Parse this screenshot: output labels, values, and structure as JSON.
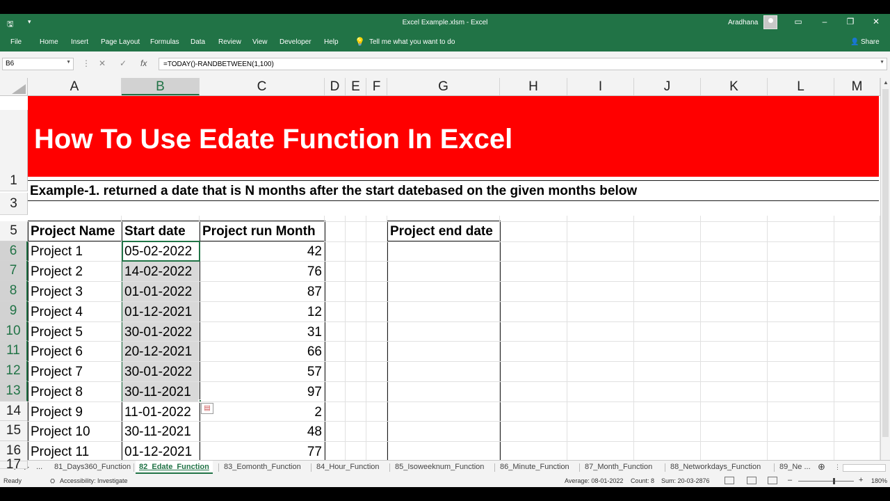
{
  "title_bar": {
    "title": "Excel Example.xlsm  -  Excel",
    "user": "Aradhana",
    "qat_save_icon": "save-icon",
    "qat_more": "▾"
  },
  "ribbon": {
    "tabs": [
      "File",
      "Home",
      "Insert",
      "Page Layout",
      "Formulas",
      "Data",
      "Review",
      "View",
      "Developer",
      "Help"
    ],
    "tell_me": "Tell me what you want to do",
    "share": "Share"
  },
  "formula_bar": {
    "name_box": "B6",
    "formula": "=TODAY()-RANDBETWEEN(1,100)",
    "fx": "fx",
    "cancel": "✕",
    "enter": "✓"
  },
  "columns": [
    {
      "label": "A",
      "selected": false
    },
    {
      "label": "B",
      "selected": true
    },
    {
      "label": "C",
      "selected": false
    },
    {
      "label": "D",
      "selected": false
    },
    {
      "label": "E",
      "selected": false
    },
    {
      "label": "F",
      "selected": false
    },
    {
      "label": "G",
      "selected": false
    },
    {
      "label": "H",
      "selected": false
    },
    {
      "label": "I",
      "selected": false
    },
    {
      "label": "J",
      "selected": false
    },
    {
      "label": "K",
      "selected": false
    },
    {
      "label": "L",
      "selected": false
    },
    {
      "label": "M",
      "selected": false
    }
  ],
  "rows": [
    {
      "label": "1",
      "selected": false
    },
    {
      "label": "3",
      "selected": false
    },
    {
      "label": "5",
      "selected": false
    },
    {
      "label": "6",
      "selected": true
    },
    {
      "label": "7",
      "selected": true
    },
    {
      "label": "8",
      "selected": true
    },
    {
      "label": "9",
      "selected": true
    },
    {
      "label": "10",
      "selected": true
    },
    {
      "label": "11",
      "selected": true
    },
    {
      "label": "12",
      "selected": true
    },
    {
      "label": "13",
      "selected": true
    },
    {
      "label": "14",
      "selected": false
    },
    {
      "label": "15",
      "selected": false
    },
    {
      "label": "16",
      "selected": false
    },
    {
      "label": "17",
      "selected": false
    }
  ],
  "sheet": {
    "banner_title": "How To Use  Edate  Function In Excel",
    "banner_color": "#ff0000",
    "example_heading": "Example-1.  returned a date that is N months after the start datebased on the given months below",
    "table_headers": [
      "Project Name",
      "Start date",
      "Project run Month"
    ],
    "result_header": "Project end date",
    "table_rows": [
      {
        "name": "Project 1",
        "start": "05-02-2022",
        "months": "42"
      },
      {
        "name": "Project 2",
        "start": "14-02-2022",
        "months": "76"
      },
      {
        "name": "Project 3",
        "start": "01-01-2022",
        "months": "87"
      },
      {
        "name": "Project 4",
        "start": "01-12-2021",
        "months": "12"
      },
      {
        "name": "Project 5",
        "start": "30-01-2022",
        "months": "31"
      },
      {
        "name": "Project 6",
        "start": "20-12-2021",
        "months": "66"
      },
      {
        "name": "Project 7",
        "start": "30-01-2022",
        "months": "57"
      },
      {
        "name": "Project 8",
        "start": "30-11-2021",
        "months": "97"
      },
      {
        "name": "Project 9",
        "start": "11-01-2022",
        "months": "2"
      },
      {
        "name": "Project 10",
        "start": "30-11-2021",
        "months": "48"
      },
      {
        "name": "Project 11",
        "start": "01-12-2021",
        "months": "77"
      }
    ]
  },
  "sheet_tabs": {
    "ellipsis": "...",
    "tabs": [
      {
        "label": "81_Days360_Function",
        "active": false
      },
      {
        "label": "82_Edate_Function",
        "active": true
      },
      {
        "label": "83_Eomonth_Function",
        "active": false
      },
      {
        "label": "84_Hour_Function",
        "active": false
      },
      {
        "label": "85_Isoweeknum_Function",
        "active": false
      },
      {
        "label": "86_Minute_Function",
        "active": false
      },
      {
        "label": "87_Month_Function",
        "active": false
      },
      {
        "label": "88_Networkdays_Function",
        "active": false
      },
      {
        "label": "89_Ne ...",
        "active": false
      }
    ],
    "add": "⊕"
  },
  "status_bar": {
    "ready": "Ready",
    "accessibility": "Accessibility: Investigate",
    "average": "Average: 08-01-2022",
    "count": "Count: 8",
    "sum": "Sum: 20-03-2876",
    "zoom": "180%"
  }
}
